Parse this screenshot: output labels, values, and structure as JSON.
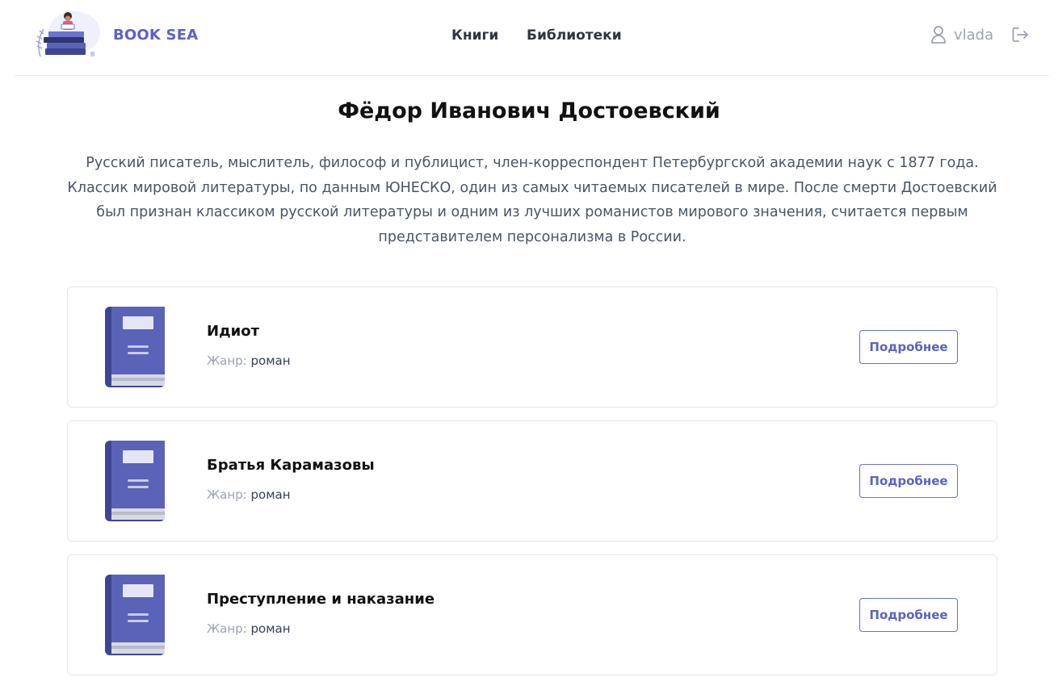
{
  "header": {
    "brand": "BOOK SEA",
    "nav": [
      {
        "label": "Книги"
      },
      {
        "label": "Библиотеки"
      }
    ],
    "user": {
      "name": "vlada"
    },
    "icons": {
      "user": "user-icon",
      "logout": "logout-icon"
    }
  },
  "author": {
    "name": "Фёдор Иванович Достоевский",
    "bio": "Русский писатель, мыслитель, философ и публицист, член-корреспондент Петербургской академии наук с 1877 года. Классик мировой литературы, по данным ЮНЕСКО, один из самых читаемых писателей в мире. После смерти Достоевский был признан классиком русской литературы и одним из лучших романистов мирового значения, считается первым представителем персонализма в России."
  },
  "books": [
    {
      "title": "Идиот",
      "genre_label": "Жанр:",
      "genre": "роман",
      "button": "Подробнее"
    },
    {
      "title": "Братья Карамазовы",
      "genre_label": "Жанр:",
      "genre": "роман",
      "button": "Подробнее"
    },
    {
      "title": "Преступление и наказание",
      "genre_label": "Жанр:",
      "genre": "роман",
      "button": "Подробнее"
    }
  ],
  "colors": {
    "accent": "#5a62c8",
    "book_cover": "#5a63b8",
    "book_spine": "#3f4690",
    "border": "#e5e7eb"
  }
}
